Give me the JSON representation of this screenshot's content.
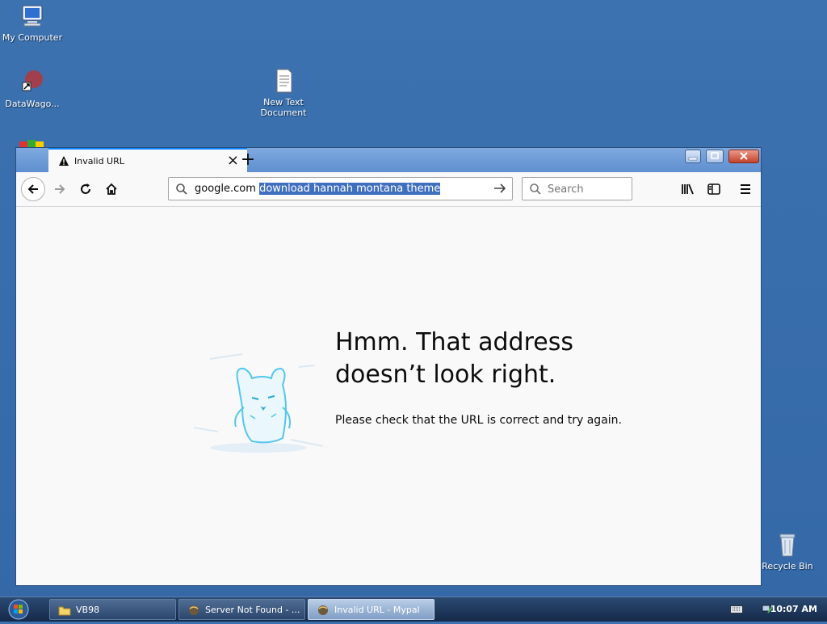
{
  "desktop": {
    "icons": [
      {
        "label": "My Computer"
      },
      {
        "label": "DataWago..."
      },
      {
        "label": "New Text Document"
      },
      {
        "label": "Recycle Bin"
      }
    ]
  },
  "browser": {
    "tab_title": "Invalid URL",
    "url_prefix": "google.com ",
    "url_selected": "download hannah montana theme",
    "search_placeholder": "Search",
    "error_title": "Hmm. That address doesn’t look right.",
    "error_description": "Please check that the URL is correct and try again."
  },
  "taskbar": {
    "items": [
      {
        "label": "VB98"
      },
      {
        "label": "Server Not Found - ..."
      },
      {
        "label": "Invalid URL - Mypal"
      }
    ],
    "clock": "10:07 AM"
  },
  "colors": {
    "desktop": "#3a6ea5",
    "tab_accent": "#0a84ff",
    "selection": "#3f6fbd"
  }
}
